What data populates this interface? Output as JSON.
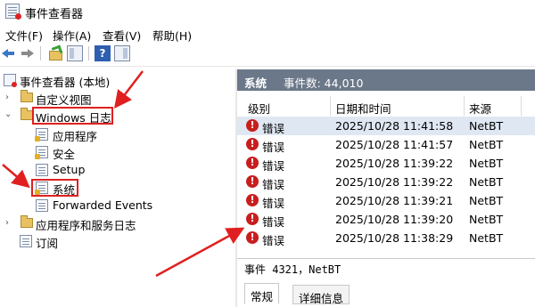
{
  "window": {
    "title": "事件查看器"
  },
  "menu": [
    {
      "label": "文件(F)"
    },
    {
      "label": "操作(A)"
    },
    {
      "label": "查看(V)"
    },
    {
      "label": "帮助(H)"
    }
  ],
  "toolbar": {
    "help_label": "?"
  },
  "tree": {
    "root": "事件查看器 (本地)",
    "custom_views": "自定义视图",
    "windows_logs": "Windows 日志",
    "logs": [
      "应用程序",
      "安全",
      "Setup",
      "系统",
      "Forwarded Events"
    ],
    "app_service_logs": "应用程序和服务日志",
    "subscriptions": "订阅"
  },
  "panel": {
    "name": "系统",
    "count_text": "事件数: 44,010",
    "columns": [
      "级别",
      "日期和时间",
      "来源"
    ],
    "events": [
      {
        "level": "错误",
        "date": "2025/10/28 11:41:58",
        "source": "NetBT"
      },
      {
        "level": "错误",
        "date": "2025/10/28 11:41:57",
        "source": "NetBT"
      },
      {
        "level": "错误",
        "date": "2025/10/28 11:39:22",
        "source": "NetBT"
      },
      {
        "level": "错误",
        "date": "2025/10/28 11:39:22",
        "source": "NetBT"
      },
      {
        "level": "错误",
        "date": "2025/10/28 11:39:21",
        "source": "NetBT"
      },
      {
        "level": "错误",
        "date": "2025/10/28 11:39:20",
        "source": "NetBT"
      },
      {
        "level": "错误",
        "date": "2025/10/28 11:38:29",
        "source": "NetBT"
      }
    ],
    "detail_title": "事件 4321，NetBT",
    "tabs": [
      "常规",
      "详细信息"
    ]
  },
  "error_icon_glyph": "!",
  "annotation_color": "#e02020"
}
